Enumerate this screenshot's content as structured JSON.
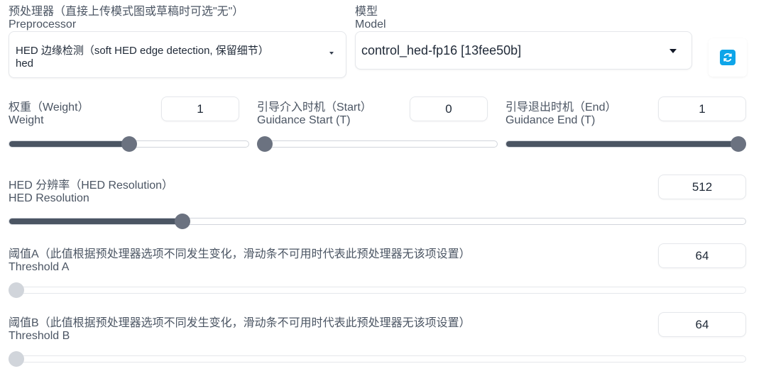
{
  "preprocessor": {
    "label_cn": "预处理器（直接上传模式图或草稿时可选\"无\"）",
    "label_en": "Preprocessor",
    "value_line1": "HED 边缘检测（soft HED edge detection, 保留细节）",
    "value_line2": "hed"
  },
  "model": {
    "label_cn": "模型",
    "label_en": "Model",
    "value": "control_hed-fp16 [13fee50b]"
  },
  "refresh": {
    "icon": "refresh-icon",
    "color": "#0ea5e9"
  },
  "weight": {
    "label_cn": "权重（Weight）",
    "label_en": "Weight",
    "value": "1",
    "fraction": 0.5
  },
  "guidance_start": {
    "label_cn": "引导介入时机（Start）",
    "label_en": "Guidance Start (T)",
    "value": "0",
    "fraction": 0.0
  },
  "guidance_end": {
    "label_cn": "引导退出时机（End）",
    "label_en": "Guidance End (T)",
    "value": "1",
    "fraction": 1.0
  },
  "hed_resolution": {
    "label_cn": "HED 分辨率（HED Resolution）",
    "label_en": "HED Resolution",
    "value": "512",
    "fraction": 0.23
  },
  "threshold_a": {
    "label_cn": "阈值A（此值根据预处理器选项不同发生变化，滑动条不可用时代表此预处理器无该项设置）",
    "label_en": "Threshold A",
    "value": "64",
    "fraction": 0.0
  },
  "threshold_b": {
    "label_cn": "阈值B（此值根据预处理器选项不同发生变化，滑动条不可用时代表此预处理器无该项设置）",
    "label_en": "Threshold B",
    "value": "64",
    "fraction": 0.0
  },
  "colors": {
    "slider_fill": "#4b5563",
    "slider_thumb": "#6b7280",
    "disabled_thumb": "#d1d5db"
  }
}
